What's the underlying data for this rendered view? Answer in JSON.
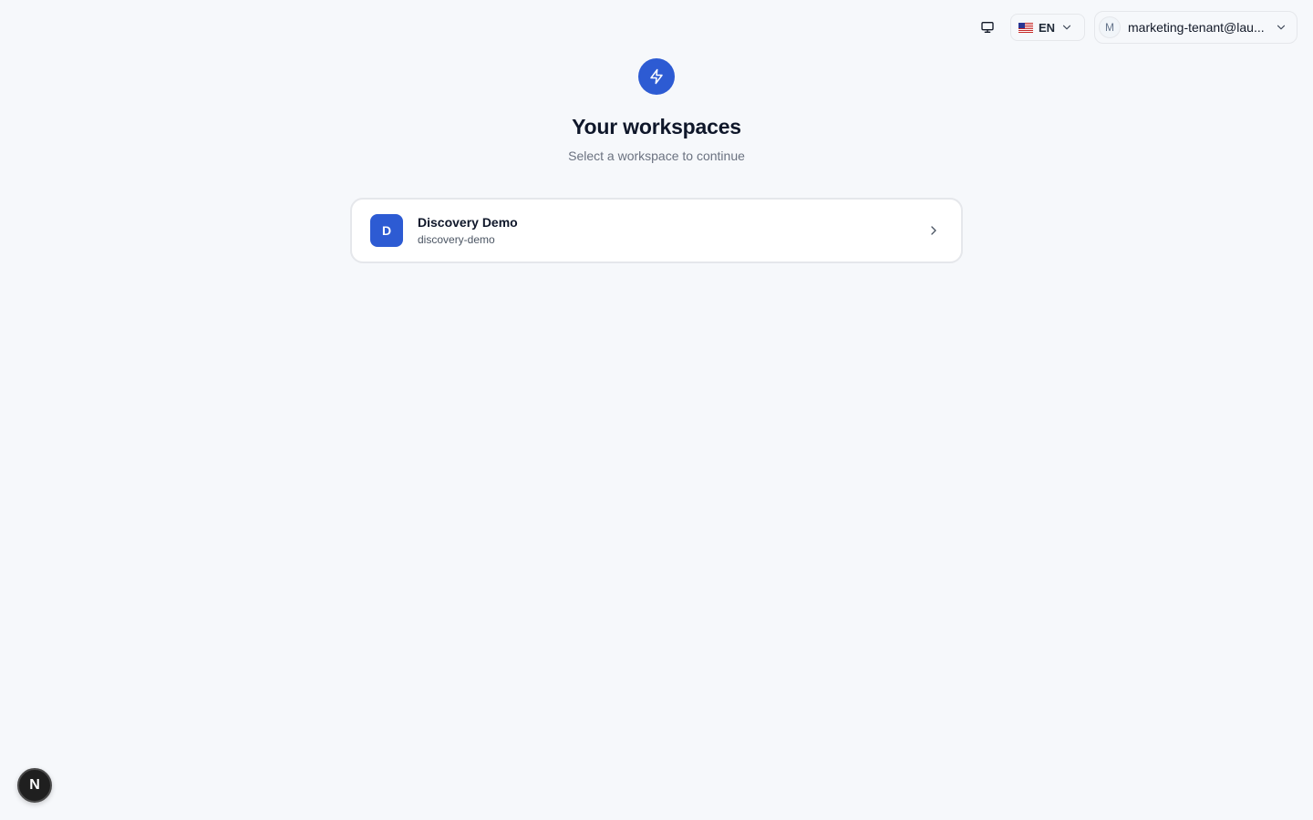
{
  "header": {
    "theme_icon": "monitor-icon",
    "language": {
      "code": "EN",
      "flag_icon": "us-flag-icon"
    },
    "user": {
      "initial": "M",
      "email": "marketing-tenant@lau..."
    }
  },
  "main": {
    "logo_icon": "lightning-icon",
    "title": "Your workspaces",
    "subtitle": "Select a workspace to continue",
    "workspaces": [
      {
        "initial": "D",
        "name": "Discovery Demo",
        "slug": "discovery-demo"
      }
    ]
  },
  "dev_badge": {
    "label": "N"
  },
  "colors": {
    "accent": "#2d5bd3",
    "background": "#f6f8fb"
  }
}
